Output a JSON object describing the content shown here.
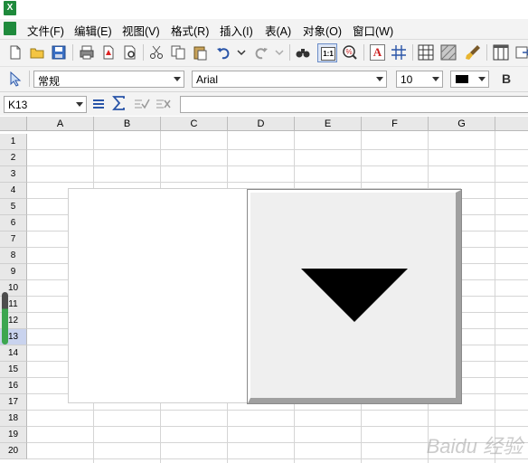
{
  "menu": {
    "items": [
      "文件(F)",
      "编辑(E)",
      "视图(V)",
      "格式(R)",
      "插入(I)",
      "表(A)",
      "对象(O)",
      "窗口(W)"
    ]
  },
  "toolbar1": {
    "icons": [
      "new-document-icon",
      "open-folder-icon",
      "save-icon",
      "print-icon",
      "pdf-export-icon",
      "print-preview-icon",
      "cut-icon",
      "copy-icon",
      "paste-icon",
      "undo-icon",
      "undo-dropdown-icon",
      "redo-icon",
      "redo-dropdown-icon",
      "find-binoculars-icon",
      "zoom-one-to-one-icon",
      "percent-zoom-icon",
      "text-a-icon",
      "grid-hash-icon",
      "table-grid-icon",
      "hatch-fill-icon",
      "brush-icon",
      "columns-icon",
      "export-icon"
    ]
  },
  "toolbar2": {
    "style_value": "常规",
    "font_value": "Arial",
    "size_value": "10",
    "color_value": "#000000",
    "bold_label": "B"
  },
  "formula": {
    "cell_ref": "K13",
    "formula_value": ""
  },
  "grid": {
    "columns": [
      "A",
      "B",
      "C",
      "D",
      "E",
      "F",
      "G"
    ],
    "rows": [
      "1",
      "2",
      "3",
      "4",
      "5",
      "6",
      "7",
      "8",
      "9",
      "10",
      "11",
      "12",
      "13",
      "14",
      "15",
      "16",
      "17",
      "18",
      "19",
      "20"
    ],
    "selected_row": "13"
  },
  "watermark": "Baidu 经验"
}
